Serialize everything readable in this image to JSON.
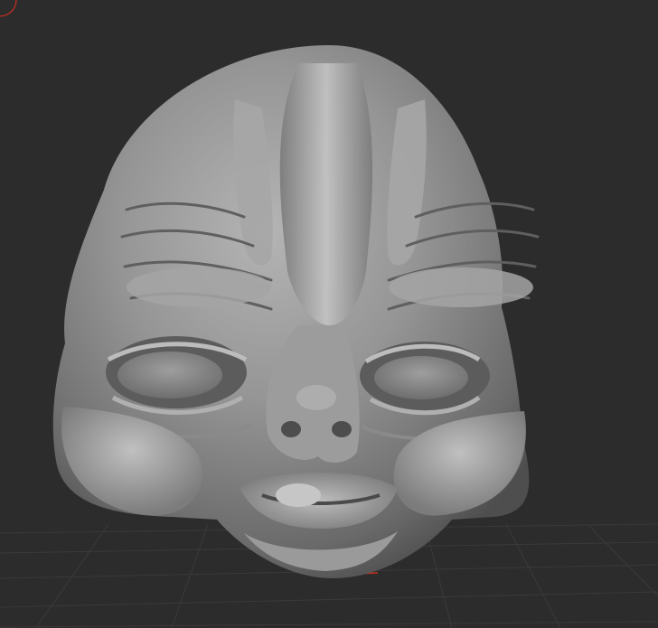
{
  "viewport": {
    "background_color": "#2c2c2c",
    "floor_grid_color": "#3a3a3a",
    "floor_axis_color": "#c8301f",
    "gizmo_color": "#c8301f"
  },
  "model": {
    "description_icon": "sculpt-head-model",
    "base_color": "#8c8c8c"
  }
}
